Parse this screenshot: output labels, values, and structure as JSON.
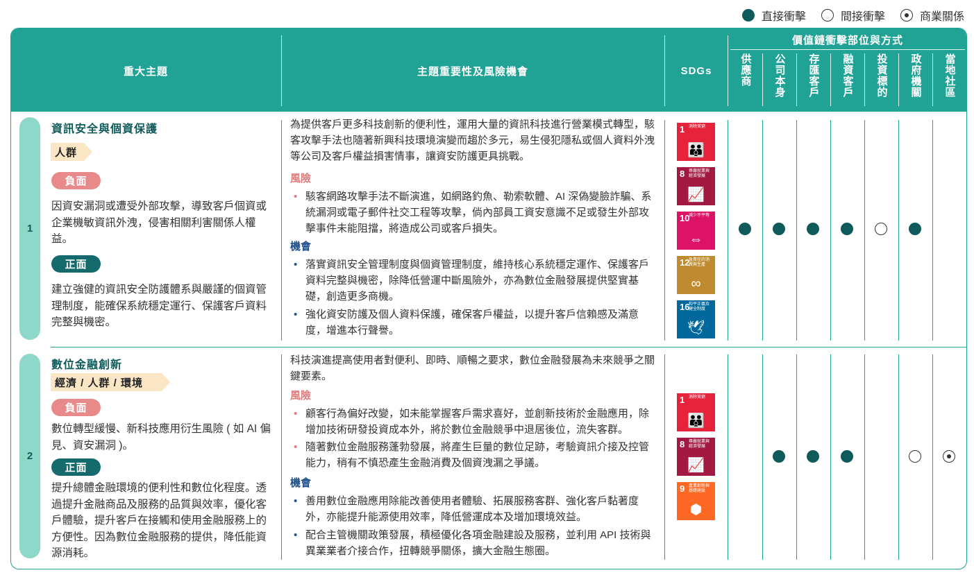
{
  "legend": {
    "direct": "直接衝擊",
    "indirect": "間接衝擊",
    "business": "商業關係"
  },
  "header": {
    "topic": "重大主題",
    "importance": "主題重要性及風險機會",
    "sdgs": "SDGs",
    "impact_group": "價值鏈衝擊部位與方式",
    "stakeholders": [
      "供應商",
      "公司本身",
      "存匯客戶",
      "融資客戶",
      "投資標的",
      "政府機關",
      "當地社區"
    ]
  },
  "rows": [
    {
      "number": "1",
      "title": "資訊安全與個資保護",
      "tag": "人群",
      "negative_label": "負面",
      "negative_text": "因資安漏洞或遭受外部攻擊，導致客戶個資或企業機敏資訊外洩，侵害相關利害關係人權益。",
      "positive_label": "正面",
      "positive_text": "建立強健的資訊安全防護體系與嚴謹的個資管理制度，能確保系統穩定運行、保護客戶資料完整與機密。",
      "intro": "為提供客戶更多科技創新的便利性，運用大量的資訊科技進行營業模式轉型，駭客攻擊手法也隨著新興科技環境演變而趨於多元，易生侵犯隱私或個人資料外洩等公司及客戶權益損害情事，讓資安防護更具挑戰。",
      "risk_label": "風險",
      "risks": [
        "駭客網路攻擊手法不斷演進，如網路釣魚、勒索軟體、AI 深偽變臉詐騙、系統漏洞或電子郵件社交工程等攻擊，倘內部員工資安意識不足或發生外部攻擊事件未能阻擋，將造成公司或客戶損失。"
      ],
      "opp_label": "機會",
      "opportunities": [
        "落實資訊安全管理制度與個資管理制度，維持核心系統穩定運作、保護客戶資料完整與機密，除降低營運中斷風險外，亦為數位金融發展提供堅實基礎，創造更多商機。",
        "強化資安防護及個人資料保護，確保客戶權益，以提升客戶信賴感及滿意度，增進本行聲譽。"
      ],
      "sdgs": [
        {
          "num": "1",
          "text": "消除貧窮",
          "color": "#e5243b",
          "icon": "family-icon",
          "glyph": "👪"
        },
        {
          "num": "8",
          "text": "尊嚴就業與經濟發展",
          "color": "#a21942",
          "icon": "growth-chart-icon",
          "glyph": "📈"
        },
        {
          "num": "10",
          "text": "減少不平等",
          "color": "#dd1367",
          "icon": "equality-icon",
          "glyph": "⇔"
        },
        {
          "num": "12",
          "text": "負責任的消費與生產",
          "color": "#bf8b2e",
          "icon": "infinity-icon",
          "glyph": "∞"
        },
        {
          "num": "16",
          "text": "和平正義及健全制度",
          "color": "#00689d",
          "icon": "dove-icon",
          "glyph": "🕊"
        }
      ],
      "impacts": [
        "direct",
        "direct",
        "direct",
        "direct",
        "indirect",
        "direct",
        ""
      ]
    },
    {
      "number": "2",
      "title": "數位金融創新",
      "tag": "經濟 / 人群 / 環境",
      "negative_label": "負面",
      "negative_text": "數位轉型緩慢、新科技應用衍生風險 ( 如 AI 偏見、資安漏洞 )。",
      "positive_label": "正面",
      "positive_text": "提升總體金融環境的便利性和數位化程度。透過提升金融商品及服務的品質與效率，優化客戶體驗，提升客戶在接觸和使用金融服務上的方便性。因為數位金融服務的提供，降低能資源消耗。",
      "intro": "科技演進提高使用者對便利、即時、順暢之要求，數位金融發展為未來競爭之關鍵要素。",
      "risk_label": "風險",
      "risks": [
        "顧客行為偏好改變，如未能掌握客戶需求喜好，並創新技術於金融應用，除增加技術研發投資成本外，將於數位金融競爭中退居後位，流失客群。",
        "隨著數位金融服務蓬勃發展，將產生巨量的數位足跡，考驗資訊介接及控管能力，稍有不慎恐產生金融消費及個資洩漏之爭議。"
      ],
      "opp_label": "機會",
      "opportunities": [
        "善用數位金融應用除能改善使用者體驗、拓展服務客群、強化客戶黏著度外，亦能提升能源使用效率，降低營運成本及增加環境效益。",
        "配合主管機關政策發展，積極優化各項金融建設及服務，並利用 API 技術與異業業者介接合作，扭轉競爭關係，擴大金融生態圈。"
      ],
      "sdgs": [
        {
          "num": "1",
          "text": "消除貧窮",
          "color": "#e5243b",
          "icon": "family-icon",
          "glyph": "👪"
        },
        {
          "num": "8",
          "text": "尊嚴就業與經濟發展",
          "color": "#a21942",
          "icon": "growth-chart-icon",
          "glyph": "📈"
        },
        {
          "num": "9",
          "text": "產業創新與基礎建設",
          "color": "#fd6925",
          "icon": "cubes-icon",
          "glyph": "⬢"
        }
      ],
      "impacts": [
        "",
        "direct",
        "direct",
        "direct",
        "",
        "indirect",
        "business"
      ]
    }
  ]
}
